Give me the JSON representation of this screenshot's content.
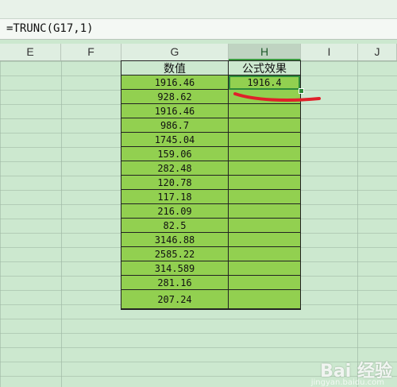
{
  "formula_bar": {
    "text": "=TRUNC(G17,1)"
  },
  "columns": [
    "E",
    "F",
    "G",
    "H",
    "I",
    "J"
  ],
  "table": {
    "headers": {
      "g": "数值",
      "h": "公式效果"
    },
    "rows": [
      {
        "g": "1916.46",
        "h": "1916.4"
      },
      {
        "g": "928.62",
        "h": ""
      },
      {
        "g": "1916.46",
        "h": ""
      },
      {
        "g": "986.7",
        "h": ""
      },
      {
        "g": "1745.04",
        "h": ""
      },
      {
        "g": "159.06",
        "h": ""
      },
      {
        "g": "282.48",
        "h": ""
      },
      {
        "g": "120.78",
        "h": ""
      },
      {
        "g": "117.18",
        "h": ""
      },
      {
        "g": "216.09",
        "h": ""
      },
      {
        "g": "82.5",
        "h": ""
      },
      {
        "g": "3146.88",
        "h": ""
      },
      {
        "g": "2585.22",
        "h": ""
      },
      {
        "g": "314.589",
        "h": ""
      },
      {
        "g": "281.16",
        "h": ""
      },
      {
        "g": "207.24",
        "h": ""
      }
    ]
  },
  "watermark": {
    "logo": "Bai 经验",
    "sub": "jingyan.baidu.com"
  },
  "colors": {
    "cell_fill": "#92d050",
    "sheet_bg": "#cce8cf",
    "selection": "#2e8b3a",
    "annotation": "#e0202a"
  }
}
